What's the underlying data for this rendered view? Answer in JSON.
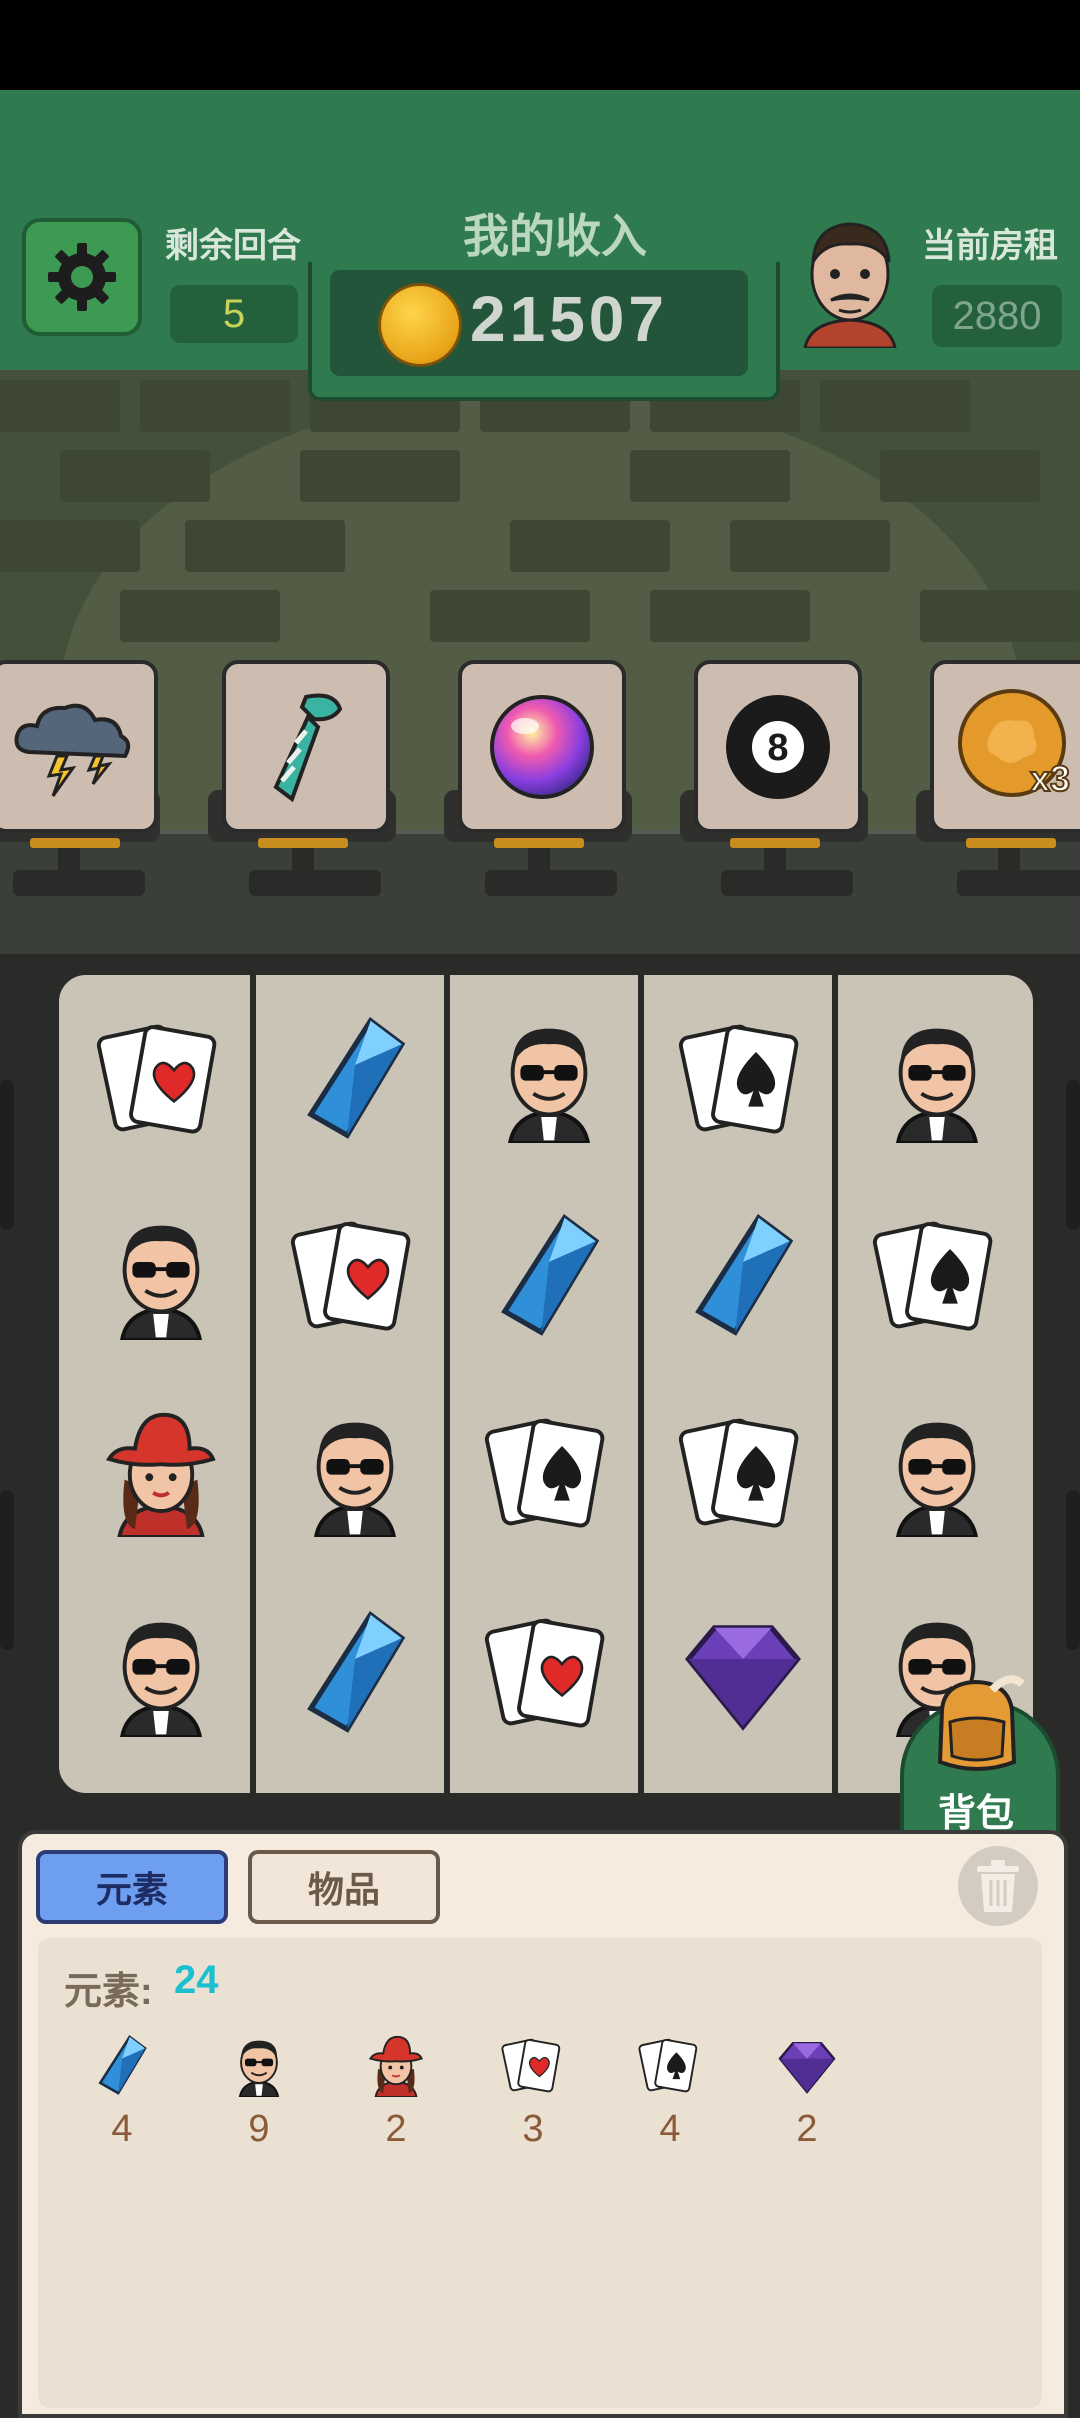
{
  "header": {
    "rounds_label": "剩余回合",
    "rounds_value": "5",
    "income_title": "我的收入",
    "income_value": "21507",
    "rent_label": "当前房租",
    "rent_value": "2880"
  },
  "items": [
    {
      "icon": "storm-cloud-icon"
    },
    {
      "icon": "necktie-icon"
    },
    {
      "icon": "rainbow-orb-icon"
    },
    {
      "icon": "eight-ball-icon"
    },
    {
      "icon": "gold-coin-icon",
      "badge": "x3"
    }
  ],
  "board": {
    "rows": [
      [
        "hearts-cards",
        "blue-crystal",
        "sunglasses-man",
        "spades-cards",
        "sunglasses-man"
      ],
      [
        "sunglasses-man",
        "hearts-cards",
        "blue-crystal",
        "blue-crystal",
        "spades-cards"
      ],
      [
        "red-hat-woman",
        "sunglasses-man",
        "spades-cards",
        "spades-cards",
        "sunglasses-man"
      ],
      [
        "sunglasses-man",
        "blue-crystal",
        "hearts-cards",
        "purple-gem",
        "sunglasses-man"
      ]
    ]
  },
  "backpack": {
    "label": "背包"
  },
  "panel": {
    "tab_elements": "元素",
    "tab_items": "物品",
    "elements_label": "元素:",
    "elements_total": "24",
    "inventory": [
      {
        "icon": "blue-crystal",
        "count": "4"
      },
      {
        "icon": "sunglasses-man",
        "count": "9"
      },
      {
        "icon": "red-hat-woman",
        "count": "2"
      },
      {
        "icon": "hearts-cards",
        "count": "3"
      },
      {
        "icon": "spades-cards",
        "count": "4"
      },
      {
        "icon": "purple-gem",
        "count": "2"
      }
    ]
  },
  "colors": {
    "header_green": "#2f7a4f",
    "active_tab": "#6e9ef0",
    "elements_count": "#1ac0cf"
  }
}
